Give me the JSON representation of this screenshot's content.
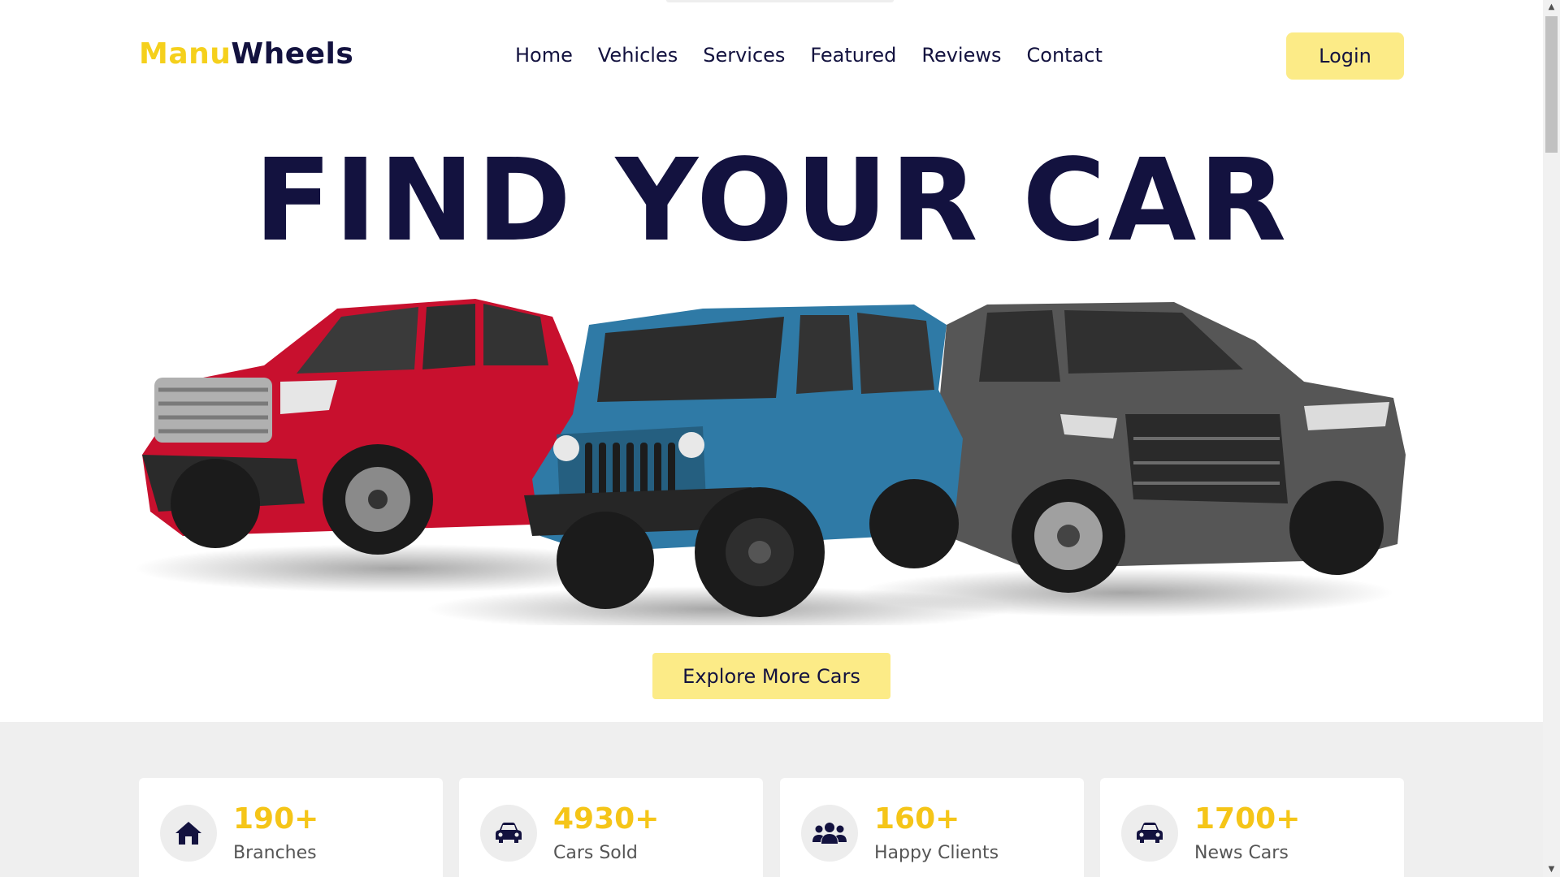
{
  "brand": {
    "part1": "Manu",
    "part2": "Wheels",
    "color_primary": "#f5d01c",
    "color_secondary": "#13123f"
  },
  "nav": {
    "items": [
      {
        "label": "Home"
      },
      {
        "label": "Vehicles"
      },
      {
        "label": "Services"
      },
      {
        "label": "Featured"
      },
      {
        "label": "Reviews"
      },
      {
        "label": "Contact"
      }
    ],
    "login_label": "Login"
  },
  "hero": {
    "title": "FIND YOUR CAR",
    "cars": [
      "red pickup truck",
      "blue jeep",
      "gray suv"
    ],
    "cta_label": "Explore More Cars"
  },
  "stats": [
    {
      "value": "190+",
      "label": "Branches",
      "icon": "home-icon"
    },
    {
      "value": "4930+",
      "label": "Cars Sold",
      "icon": "car-icon"
    },
    {
      "value": "160+",
      "label": "Happy Clients",
      "icon": "users-icon"
    },
    {
      "value": "1700+",
      "label": "News Cars",
      "icon": "car-icon"
    }
  ],
  "colors": {
    "accent": "#fceb87",
    "stat_value": "#f5c518",
    "stats_bg": "#efefef"
  }
}
